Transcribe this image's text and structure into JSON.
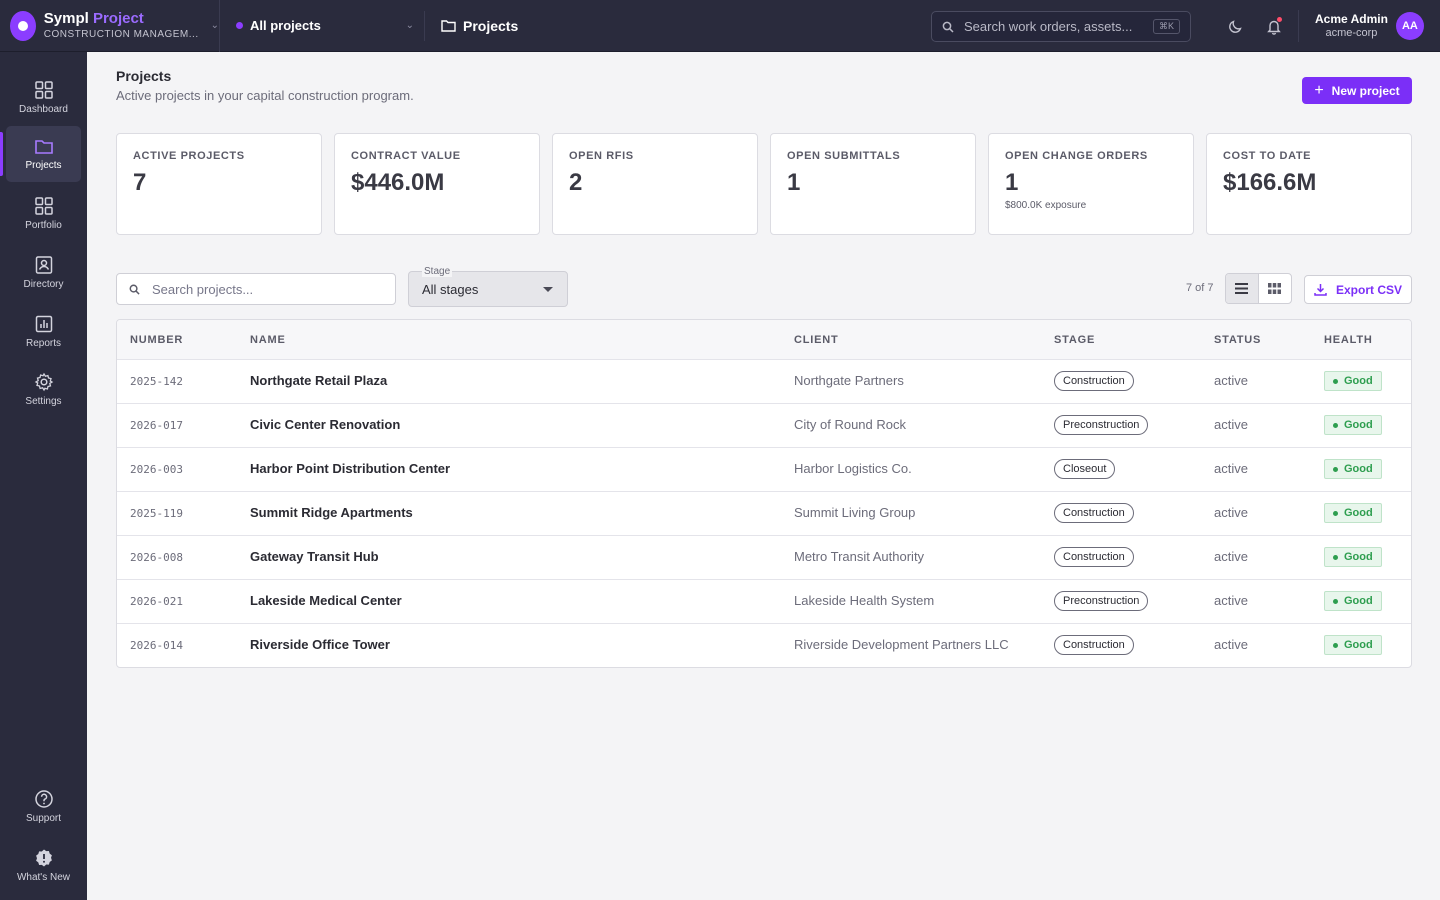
{
  "brand": {
    "name_part1": "Sympl",
    "name_part2": "Project",
    "subtitle": "CONSTRUCTION MANAGEM..."
  },
  "project_selector": {
    "label": "All projects"
  },
  "breadcrumb": {
    "label": "Projects"
  },
  "global_search": {
    "placeholder": "Search work orders, assets...",
    "shortcut": "⌘K"
  },
  "user": {
    "name": "Acme Admin",
    "org": "acme-corp",
    "initials": "AA"
  },
  "sidebar": {
    "items": [
      {
        "label": "Dashboard",
        "icon": "dashboard-icon"
      },
      {
        "label": "Projects",
        "icon": "folder-icon",
        "active": true
      },
      {
        "label": "Portfolio",
        "icon": "grid-icon"
      },
      {
        "label": "Directory",
        "icon": "contact-card-icon"
      },
      {
        "label": "Reports",
        "icon": "bar-chart-icon"
      },
      {
        "label": "Settings",
        "icon": "gear-icon"
      }
    ],
    "bottom": [
      {
        "label": "Support",
        "icon": "help-circle-icon"
      },
      {
        "label": "What's New",
        "icon": "badge-alert-icon"
      }
    ]
  },
  "page": {
    "title": "Projects",
    "subtitle": "Active projects in your capital construction program.",
    "new_button": "New project"
  },
  "stats": [
    {
      "label": "ACTIVE PROJECTS",
      "value": "7",
      "note": ""
    },
    {
      "label": "CONTRACT VALUE",
      "value": "$446.0M",
      "note": ""
    },
    {
      "label": "OPEN RFIS",
      "value": "2",
      "note": ""
    },
    {
      "label": "OPEN SUBMITTALS",
      "value": "1",
      "note": ""
    },
    {
      "label": "OPEN CHANGE ORDERS",
      "value": "1",
      "note": "$800.0K exposure"
    },
    {
      "label": "COST TO DATE",
      "value": "$166.6M",
      "note": ""
    }
  ],
  "filters": {
    "search_placeholder": "Search projects...",
    "stage_label": "Stage",
    "stage_value": "All stages",
    "count": "7 of 7",
    "export_label": "Export CSV"
  },
  "table": {
    "headers": [
      "NUMBER",
      "NAME",
      "CLIENT",
      "STAGE",
      "STATUS",
      "HEALTH"
    ],
    "rows": [
      {
        "number": "2025-142",
        "name": "Northgate Retail Plaza",
        "client": "Northgate Partners",
        "stage": "Construction",
        "status": "active",
        "health": "Good"
      },
      {
        "number": "2026-017",
        "name": "Civic Center Renovation",
        "client": "City of Round Rock",
        "stage": "Preconstruction",
        "status": "active",
        "health": "Good"
      },
      {
        "number": "2026-003",
        "name": "Harbor Point Distribution Center",
        "client": "Harbor Logistics Co.",
        "stage": "Closeout",
        "status": "active",
        "health": "Good"
      },
      {
        "number": "2025-119",
        "name": "Summit Ridge Apartments",
        "client": "Summit Living Group",
        "stage": "Construction",
        "status": "active",
        "health": "Good"
      },
      {
        "number": "2026-008",
        "name": "Gateway Transit Hub",
        "client": "Metro Transit Authority",
        "stage": "Construction",
        "status": "active",
        "health": "Good"
      },
      {
        "number": "2026-021",
        "name": "Lakeside Medical Center",
        "client": "Lakeside Health System",
        "stage": "Preconstruction",
        "status": "active",
        "health": "Good"
      },
      {
        "number": "2026-014",
        "name": "Riverside Office Tower",
        "client": "Riverside Development Partners LLC",
        "stage": "Construction",
        "status": "active",
        "health": "Good"
      }
    ]
  },
  "colors": {
    "accent": "#7b2ff7",
    "sidebar_bg": "#2a2b3d",
    "health_good": "#2e9e4f"
  }
}
